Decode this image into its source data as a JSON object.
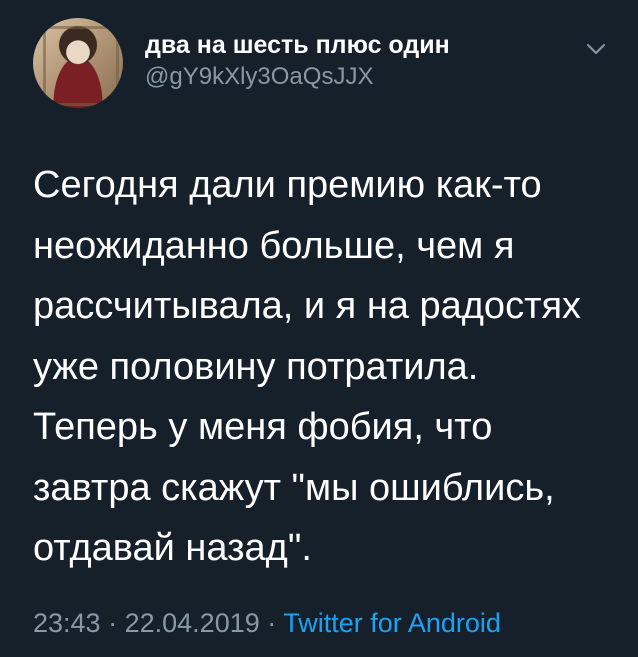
{
  "author": {
    "display_name": "два на шесть плюс один",
    "handle": "@gY9kXly3OaQsJJX"
  },
  "tweet": {
    "lines": [
      "Сегодня дали премию как-то",
      "неожиданно больше, чем я",
      "рассчитывала, и я на радостях",
      "уже половину потратила.",
      "Теперь у меня фобия, что",
      "завтра скажут \"мы ошиблись,",
      "отдавай назад\"."
    ]
  },
  "meta": {
    "time": "23:43",
    "separator": "·",
    "date": "22.04.2019",
    "source": "Twitter for Android"
  },
  "colors": {
    "background": "#15202b",
    "text": "#ffffff",
    "secondary_text": "#8899a6",
    "link": "#1da1f2"
  },
  "icons": {
    "more": "chevron-down-icon"
  }
}
